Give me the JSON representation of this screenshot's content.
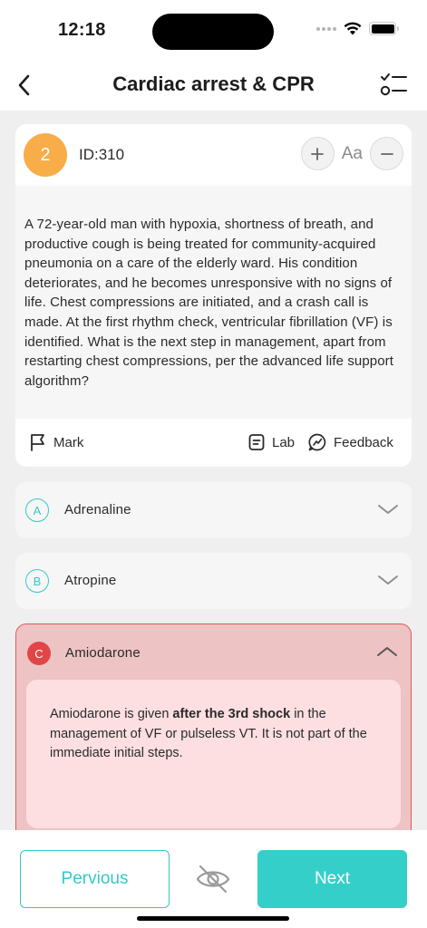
{
  "status_bar": {
    "time": "12:18"
  },
  "header": {
    "title": "Cardiac arrest & CPR"
  },
  "question": {
    "number": "2",
    "id_label": "ID:310",
    "font_size_label": "Aa",
    "text": "A 72-year-old man with hypoxia, shortness of breath, and productive cough is being treated for community-acquired pneumonia on a care of the elderly ward. His condition deteriorates, and he becomes unresponsive with no signs of life. Chest compressions are initiated, and a crash call is made. At the first rhythm check, ventricular fibrillation (VF) is identified. What is the next step in management, apart from restarting chest compressions, per the advanced life support algorithm?",
    "actions": {
      "mark": "Mark",
      "lab": "Lab",
      "feedback": "Feedback"
    }
  },
  "options": [
    {
      "letter": "A",
      "label": "Adrenaline",
      "state": "collapsed"
    },
    {
      "letter": "B",
      "label": "Atropine",
      "state": "collapsed"
    },
    {
      "letter": "C",
      "label": "Amiodarone",
      "state": "expanded-incorrect",
      "explanation_pre": "Amiodarone is given ",
      "explanation_bold": "after the 3rd shock",
      "explanation_post": " in the management of VF or pulseless VT. It is not part of the immediate initial steps."
    }
  ],
  "footer": {
    "previous_label": "Pervious",
    "next_label": "Next"
  },
  "colors": {
    "accent": "#35cfc9",
    "number_badge": "#f8ad48",
    "incorrect": "#e04646",
    "incorrect_bg": "#eec3c4"
  },
  "icons": [
    "back-chevron-icon",
    "checklist-icon",
    "plus-icon",
    "minus-icon",
    "flag-icon",
    "lab-icon",
    "feedback-icon",
    "chevron-down-icon",
    "chevron-up-icon",
    "eye-off-icon"
  ]
}
